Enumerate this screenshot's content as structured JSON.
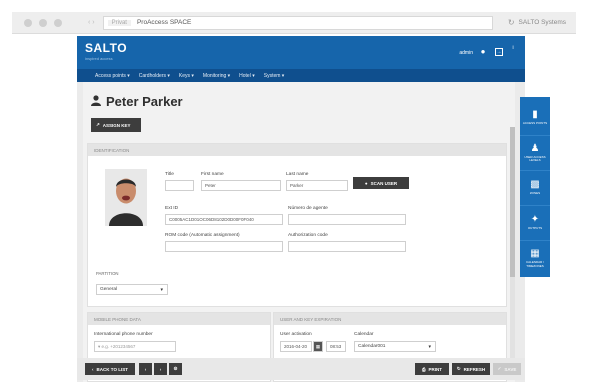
{
  "browser": {
    "back_forward": "‹ ›",
    "secure_label": "Privat",
    "tab_title": "ProAccess SPACE",
    "refresh_icon": "refresh-icon",
    "right_label": "SALTO Systems"
  },
  "header": {
    "logo": "SALTO",
    "logo_sub": "inspired access",
    "user": "admin",
    "small": "i"
  },
  "nav": {
    "items": [
      "Access points ▾",
      "Cardholders ▾",
      "Keys ▾",
      "Monitoring ▾",
      "Hotel ▾",
      "System ▾"
    ]
  },
  "page": {
    "title": "Peter Parker",
    "assign_key": "ASSIGN KEY"
  },
  "identification": {
    "header": "IDENTIFICATION",
    "title_label": "Title",
    "first_name_label": "First name",
    "first_name_value": "Peter",
    "last_name_label": "Last name",
    "last_name_value": "Parker",
    "scan_user": "SCAN USER",
    "ext_id_label": "Ext ID",
    "ext_id_value": "C0005AC1D01OC06D8102D0D00F0F040",
    "numero_label": "Número de agente",
    "rom_label": "ROM code (Automatic assignment)",
    "auth_label": "Authorization code",
    "partition_label": "PARTITION",
    "partition_value": "General"
  },
  "mobile": {
    "header": "MOBILE PHONE DATA",
    "intl_label": "International phone number",
    "intl_value": "▾ e.g. +201234567"
  },
  "usercal": {
    "header": "USER AND KEY EXPIRATION",
    "activation_label": "User activation",
    "activation_date": "2016-04-20",
    "activation_time": "08:53",
    "calendar_label": "Calendar",
    "calendar_value": "Calendar001"
  },
  "dock": [
    {
      "label": "ACCESS POINTS",
      "icon": "door-icon"
    },
    {
      "label": "USER ACCESS LEVELS",
      "icon": "users-icon"
    },
    {
      "label": "ZONES",
      "icon": "zones-icon"
    },
    {
      "label": "OUTPUTS",
      "icon": "outputs-icon"
    },
    {
      "label": "CALENDAR / TIMEZONES",
      "icon": "calendar-icon"
    }
  ],
  "footer": {
    "back": "BACK TO LIST",
    "print": "PRINT",
    "refresh": "REFRESH",
    "save": "SAVE"
  },
  "colors": {
    "brand": "#1665ab",
    "nav": "#0f4f8e",
    "dock": "#1a6fb8",
    "button_dark": "#3d3d3d"
  }
}
